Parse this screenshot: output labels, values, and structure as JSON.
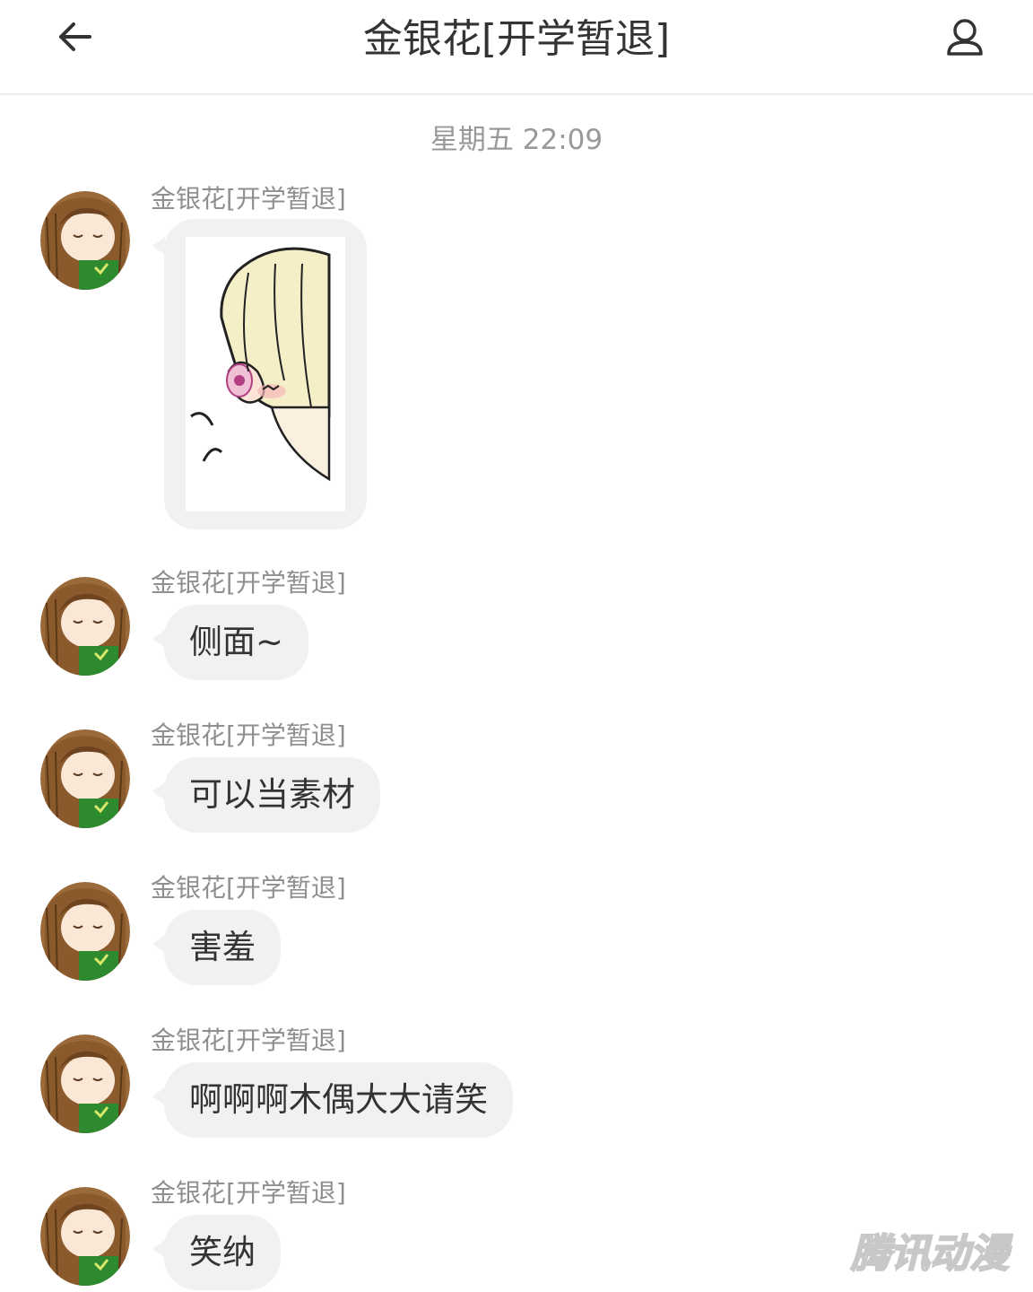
{
  "header": {
    "title": "金银花[开学暂退]"
  },
  "timestamp": "星期五 22:09",
  "sender_name": "金银花[开学暂退]",
  "messages": [
    {
      "type": "image",
      "sender": "金银花[开学暂退]",
      "sticker": "blonde-girl-side-profile-blushing"
    },
    {
      "type": "text",
      "sender": "金银花[开学暂退]",
      "text": "侧面~"
    },
    {
      "type": "text",
      "sender": "金银花[开学暂退]",
      "text": "可以当素材"
    },
    {
      "type": "text",
      "sender": "金银花[开学暂退]",
      "text": "害羞"
    },
    {
      "type": "text",
      "sender": "金银花[开学暂退]",
      "text": "啊啊啊木偶大大请笑"
    },
    {
      "type": "text",
      "sender": "金银花[开学暂退]",
      "text": "笑纳"
    }
  ],
  "watermark": "腾讯动漫",
  "icons": {
    "back": "arrow-left-icon",
    "profile": "person-icon"
  }
}
